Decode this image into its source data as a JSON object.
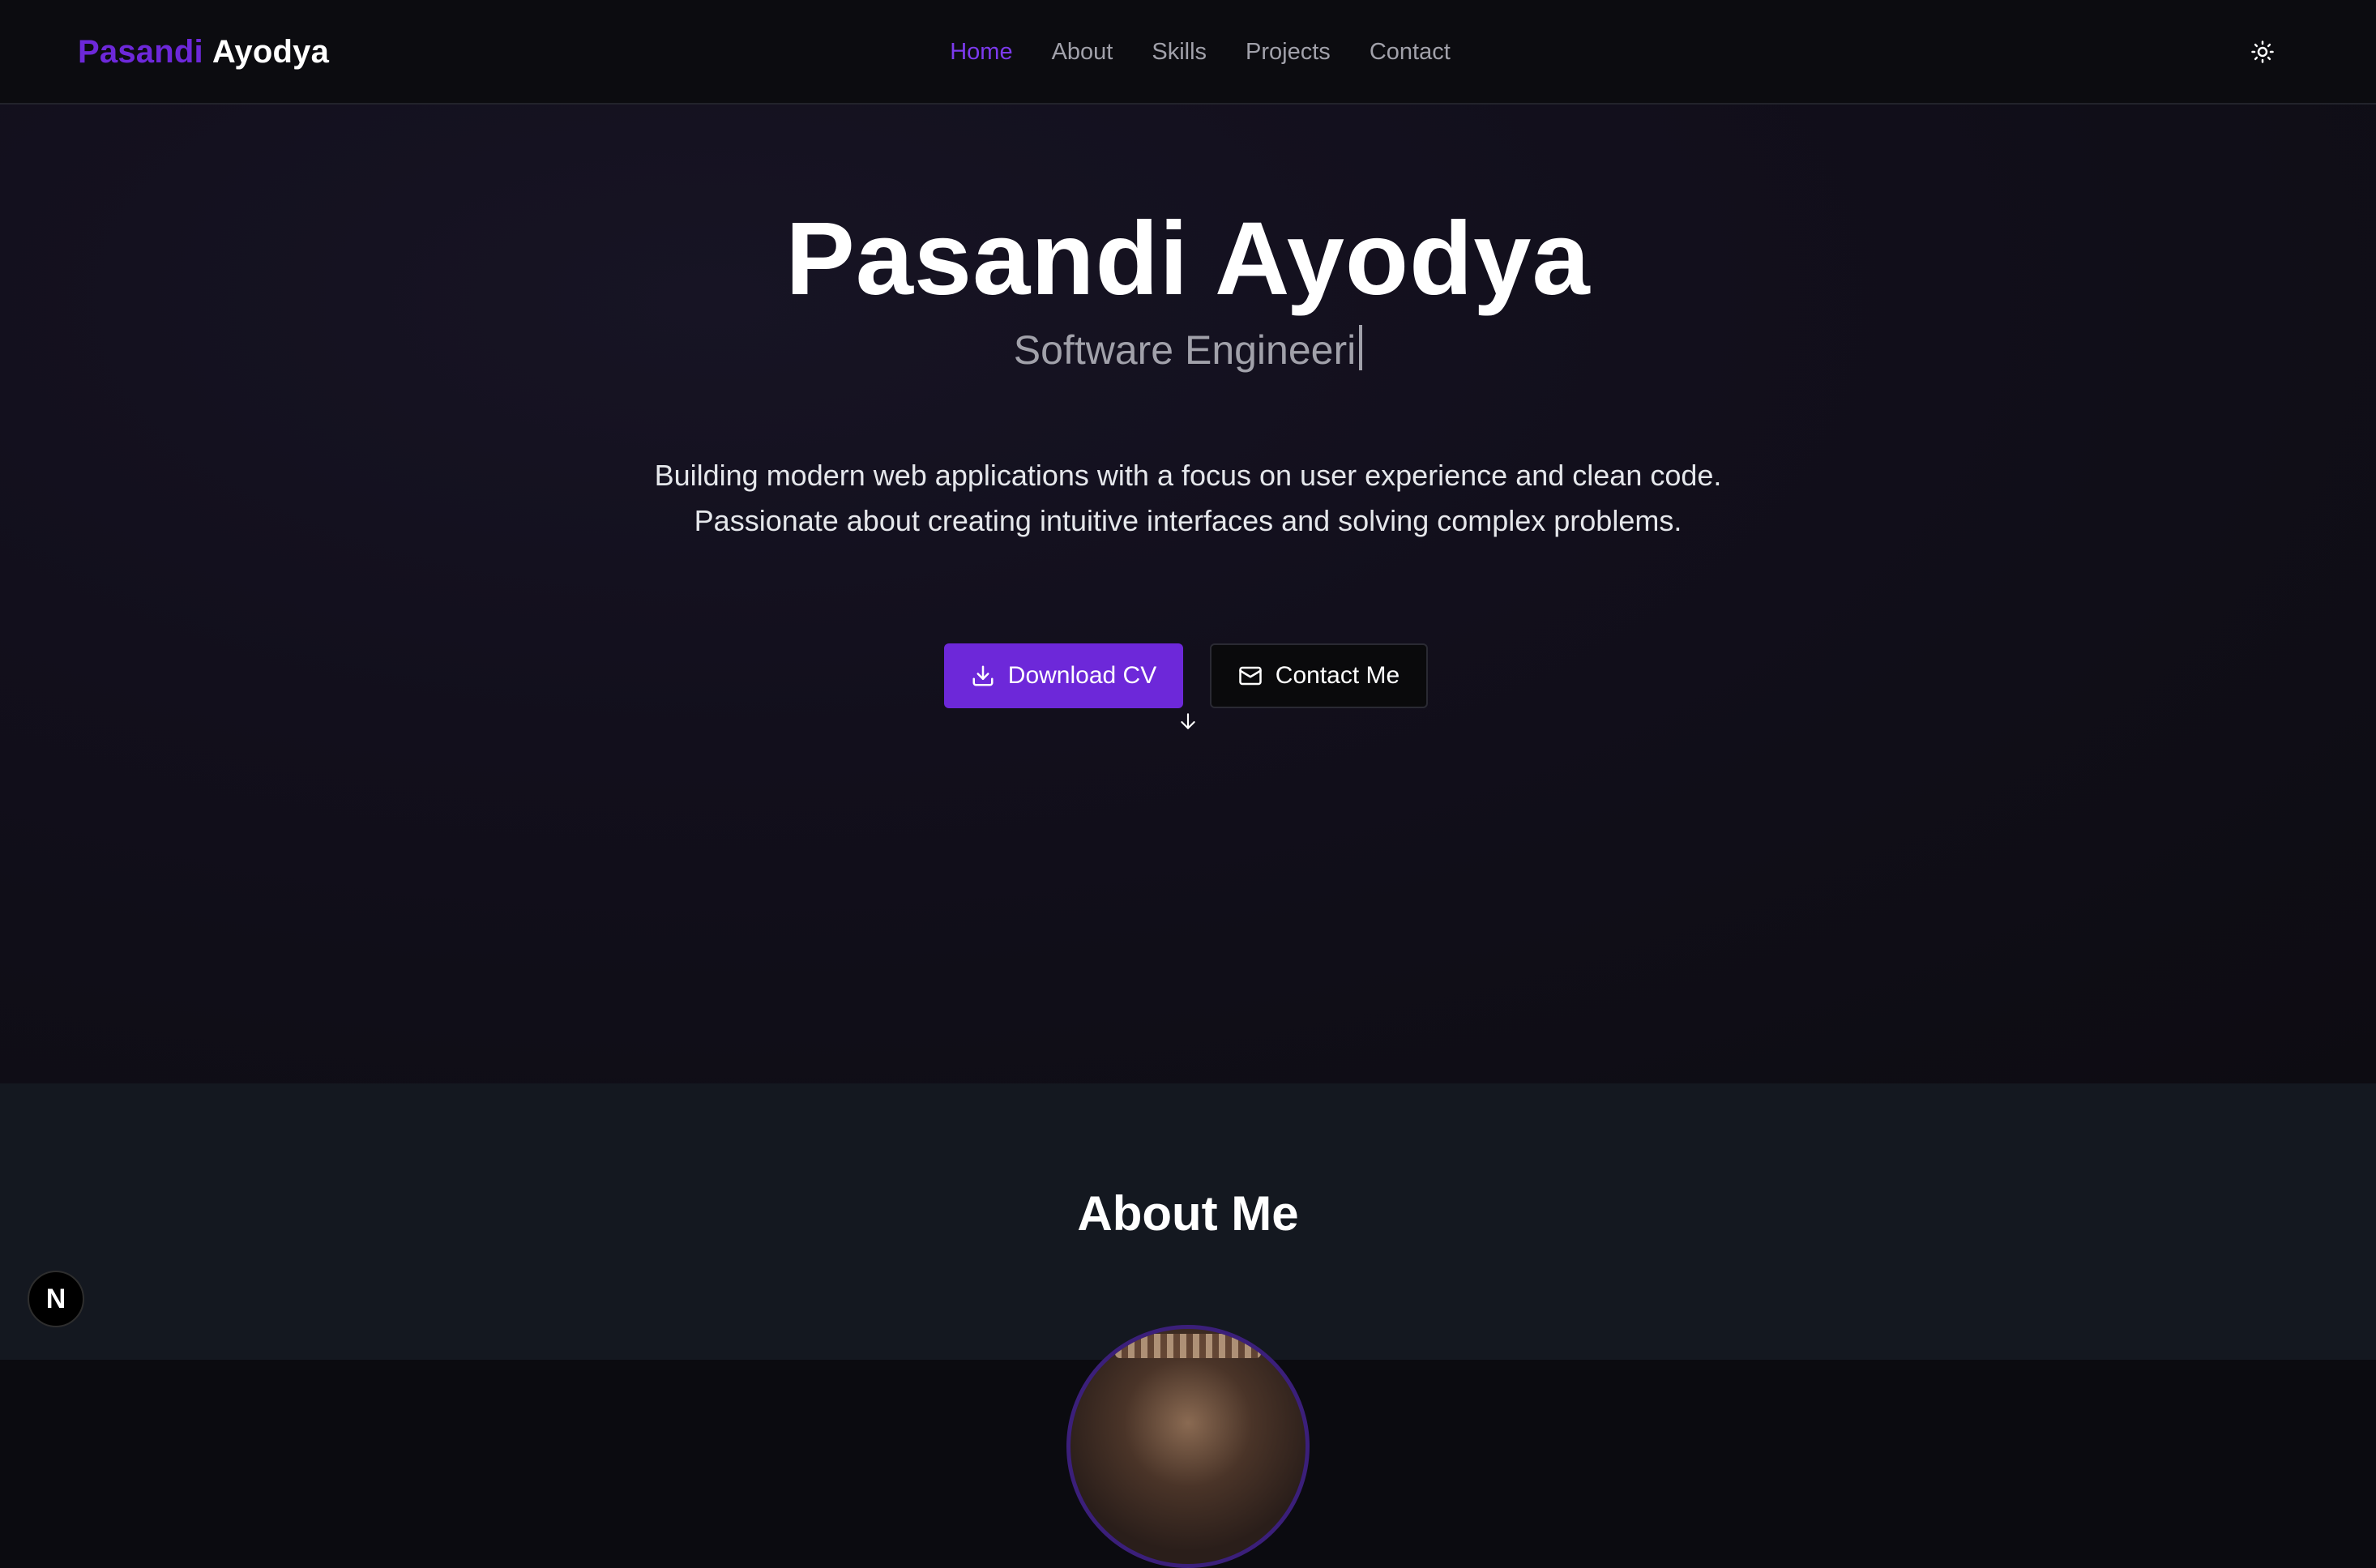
{
  "header": {
    "logo_first": "Pasandi",
    "logo_last": "Ayodya",
    "nav": [
      {
        "label": "Home",
        "active": true
      },
      {
        "label": "About",
        "active": false
      },
      {
        "label": "Skills",
        "active": false
      },
      {
        "label": "Projects",
        "active": false
      },
      {
        "label": "Contact",
        "active": false
      }
    ],
    "theme_toggle_icon": "sun-icon"
  },
  "hero": {
    "name": "Pasandi Ayodya",
    "role": "Software Engineeri",
    "description": "Building modern web applications with a focus on user experience and clean code. Passionate about creating intuitive interfaces and solving complex problems.",
    "primary_button": {
      "label": "Download CV",
      "icon": "download-icon"
    },
    "secondary_button": {
      "label": "Contact Me",
      "icon": "mail-icon"
    },
    "scroll_icon": "arrow-down-icon"
  },
  "about": {
    "title": "About Me"
  },
  "dev_badge": {
    "label": "N"
  },
  "colors": {
    "accent": "#6d28d9",
    "nav_active": "#7c3aed",
    "background": "#0b0b10",
    "about_background": "#141820"
  }
}
